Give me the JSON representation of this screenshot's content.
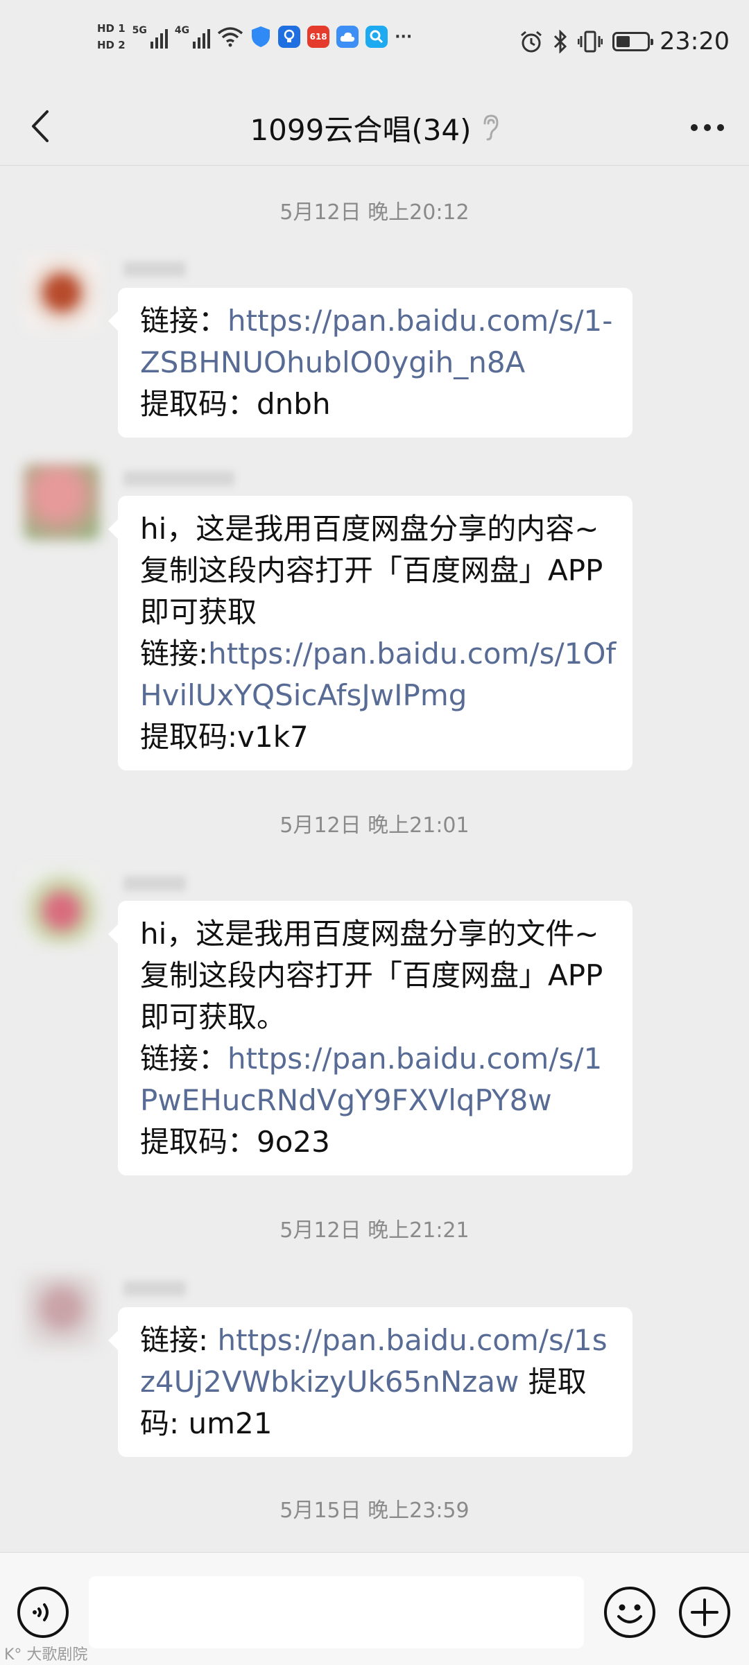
{
  "status_bar": {
    "sim_labels": [
      "HD 1",
      "HD 2"
    ],
    "network_1": "5G",
    "network_2": "4G",
    "more_icons": "···",
    "app_icons": [
      "shield-icon",
      "bulb-app-icon",
      "618-app-icon",
      "cloud-app-icon",
      "search-app-icon"
    ],
    "time": "23:20"
  },
  "header": {
    "title": "1099云合唱(34)"
  },
  "messages": [
    {
      "timestamp": "5月12日 晚上20:12",
      "lines": [
        {
          "prefix": "链接：",
          "link": "https://pan.baidu.com/s/1-ZSBHNUOhublO0ygih_n8A"
        },
        {
          "text": "提取码：dnbh"
        }
      ]
    },
    {
      "lines": [
        {
          "text": "hi，这是我用百度网盘分享的内容~复制这段内容打开「百度网盘」APP 即可获取"
        },
        {
          "prefix": "链接:",
          "link": "https://pan.baidu.com/s/1OfHvilUxYQSicAfsJwIPmg"
        },
        {
          "text": "提取码:v1k7"
        }
      ]
    },
    {
      "timestamp": "5月12日 晚上21:01",
      "lines": [
        {
          "text": "hi，这是我用百度网盘分享的文件~复制这段内容打开「百度网盘」APP 即可获取。"
        },
        {
          "prefix": "链接：",
          "link": "https://pan.baidu.com/s/1PwEHucRNdVgY9FXVlqPY8w"
        },
        {
          "text": "提取码：9o23"
        }
      ]
    },
    {
      "timestamp": "5月12日 晚上21:21",
      "lines": [
        {
          "prefix": "链接: ",
          "link": "https://pan.baidu.com/s/1sz4Uj2VWbkizyUk65nNzaw",
          "suffix": " 提取码: um21"
        }
      ]
    }
  ],
  "last_timestamp": "5月15日 晚上23:59",
  "watermark": "K° 大歌剧院",
  "colors": {
    "background": "#ededed",
    "bubble": "#ffffff",
    "link": "#576b95",
    "timestamp": "#8a8a8a"
  }
}
